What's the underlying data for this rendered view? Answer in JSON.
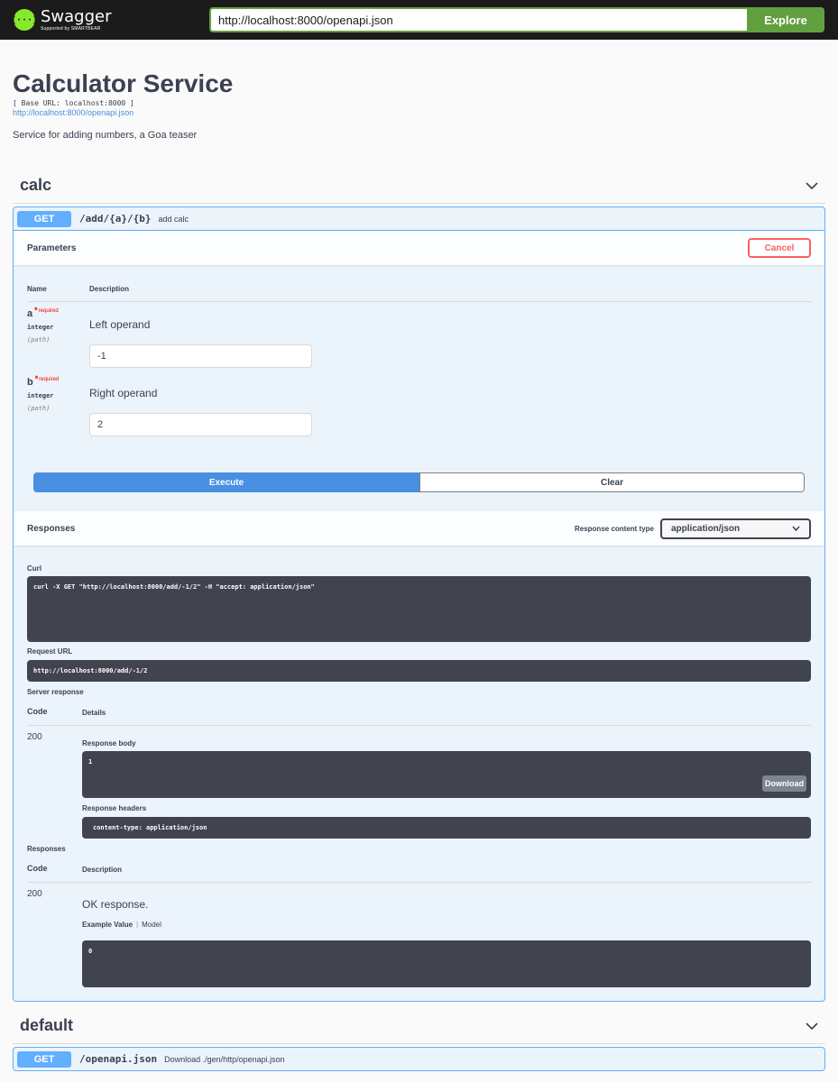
{
  "topbar": {
    "logo_title": "Swagger",
    "logo_sub": "Supported by SMARTBEAR",
    "url_value": "http://localhost:8000/openapi.json",
    "explore_label": "Explore"
  },
  "info": {
    "title": "Calculator Service",
    "base_url": "[ Base URL: localhost:8000 ]",
    "spec_link": "http://localhost:8000/openapi.json",
    "description": "Service for adding numbers, a Goa teaser"
  },
  "tags": [
    {
      "name": "calc",
      "operation": {
        "method": "GET",
        "path": "/add/{a}/{b}",
        "summary": "add calc",
        "parameters_title": "Parameters",
        "cancel_label": "Cancel",
        "col_name": "Name",
        "col_description": "Description",
        "params": [
          {
            "name": "a",
            "required_star": "*",
            "required_label": "required",
            "type": "integer",
            "in": "(path)",
            "description": "Left operand",
            "value": "-1"
          },
          {
            "name": "b",
            "required_star": "*",
            "required_label": "required",
            "type": "integer",
            "in": "(path)",
            "description": "Right operand",
            "value": "2"
          }
        ],
        "execute_label": "Execute",
        "clear_label": "Clear",
        "responses_title": "Responses",
        "content_type_label": "Response content type",
        "content_type_value": "application/json",
        "curl_label": "Curl",
        "curl_command": "curl -X GET \"http://localhost:8000/add/-1/2\" -H \"accept: application/json\"",
        "request_url_label": "Request URL",
        "request_url": "http://localhost:8000/add/-1/2",
        "server_response_label": "Server response",
        "code_col": "Code",
        "details_col": "Details",
        "server_code": "200",
        "response_body_label": "Response body",
        "response_body": "1",
        "download_label": "Download",
        "response_headers_label": "Response headers",
        "response_headers": "content-type: application/json",
        "responses_label": "Responses",
        "desc_col": "Description",
        "doc_code": "200",
        "doc_description": "OK response.",
        "example_value_tab": "Example Value",
        "model_tab": "Model",
        "example_value": "0"
      }
    },
    {
      "name": "default",
      "operation": {
        "method": "GET",
        "path": "/openapi.json",
        "summary": "Download ./gen/http/openapi.json"
      }
    }
  ],
  "colors": {
    "get": "#61affe",
    "explore": "#62a03f",
    "execute": "#4990e2",
    "cancel": "#ff6060",
    "codeblock": "#41444e"
  }
}
